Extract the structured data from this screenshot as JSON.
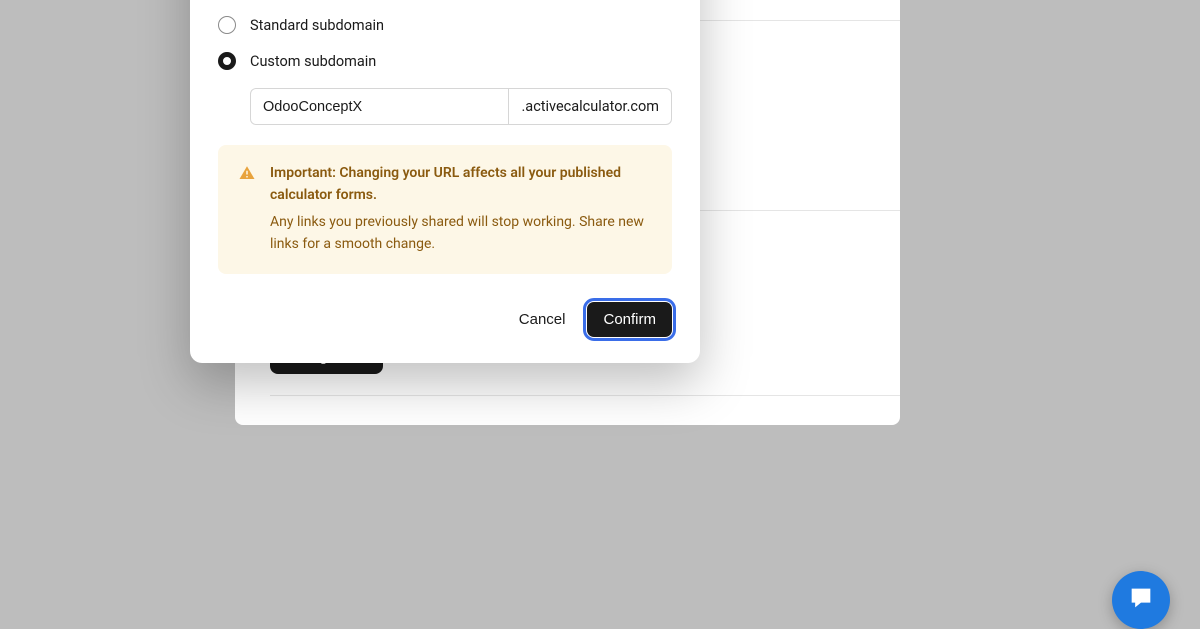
{
  "page": {
    "change_url_button": "Change URL"
  },
  "modal": {
    "options": {
      "standard_label": "Standard subdomain",
      "custom_label": "Custom subdomain"
    },
    "subdomain_input_value": "OdooConceptX",
    "subdomain_suffix": ".activecalculator.com",
    "warning": {
      "title": "Important: Changing your URL affects all your published calculator forms.",
      "body": "Any links you previously shared will stop working. Share new links for a smooth change."
    },
    "buttons": {
      "cancel": "Cancel",
      "confirm": "Confirm"
    }
  },
  "chat_fab": {
    "icon": "chat"
  }
}
